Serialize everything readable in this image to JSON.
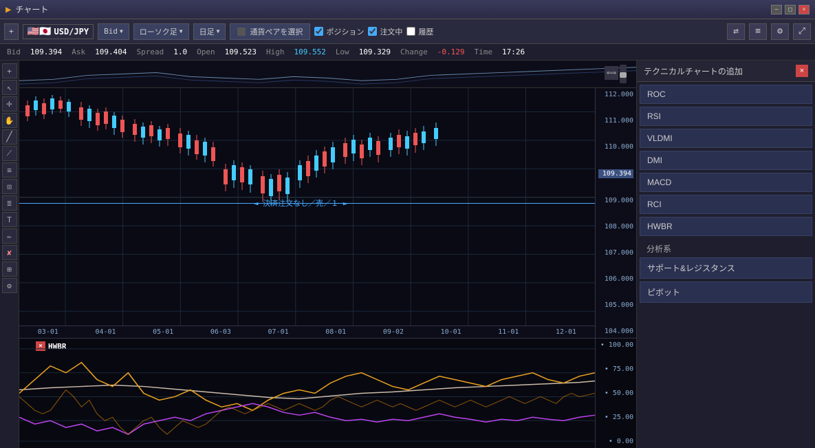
{
  "titleBar": {
    "icon": "▶",
    "title": "チャート",
    "buttons": [
      "—",
      "□",
      "×"
    ]
  },
  "toolbar": {
    "addBtn": "+",
    "pairFlag": "🇺🇸",
    "pairName": "USD/JPY",
    "priceType": "Bid",
    "chartType": "ローソク足",
    "timeframe": "日足",
    "pairSelectBtn": "通貨ペアを選択",
    "positionCheck": "ポジション",
    "orderCheck": "注文中",
    "historyCheck": "履歴",
    "iconBtns": [
      "⇄",
      "≡",
      "⚙",
      "⤢"
    ]
  },
  "priceBar": {
    "bidLabel": "Bid",
    "bidValue": "109.394",
    "askLabel": "Ask",
    "askValue": "109.404",
    "spreadLabel": "Spread",
    "spreadValue": "1.0",
    "openLabel": "Open",
    "openValue": "109.523",
    "highLabel": "High",
    "highValue": "109.552",
    "lowLabel": "Low",
    "lowValue": "109.329",
    "changeLabel": "Change",
    "changeValue": "-0.129",
    "timeLabel": "Time",
    "timeValue": "17:26"
  },
  "chart": {
    "priceAxis": [
      "112.000",
      "111.000",
      "110.000",
      "109.000",
      "108.000",
      "107.000",
      "106.000",
      "105.000",
      "104.000"
    ],
    "currentPrice": "109.394",
    "dateAxis": [
      "03-01",
      "04-01",
      "05-01",
      "06-03",
      "07-01",
      "08-01",
      "09-02",
      "10-01",
      "11-01",
      "12-01"
    ],
    "positionLabel": "◄ 決済注文なし／売／１ ►"
  },
  "subChart": {
    "label": "HWBR",
    "priceAxis": [
      "100.00",
      "75.00",
      "50.00",
      "25.00",
      "0.00"
    ]
  },
  "rightPanel": {
    "title": "テクニカルチャートの追加",
    "indicators": [
      "ROC",
      "RSI",
      "VLDMI",
      "DMI",
      "MACD",
      "RCI",
      "HWBR"
    ],
    "sectionLabel": "分析系",
    "analysisIndicators": [
      "サポート&レジスタンス",
      "ピボット"
    ]
  },
  "leftSidebar": {
    "buttons": [
      "+",
      "↖",
      "✦",
      "✋",
      "✏",
      "⟋",
      "≡",
      "⊞",
      "↓",
      "≡",
      "≡",
      "↓",
      "⚡",
      "⊞"
    ]
  }
}
